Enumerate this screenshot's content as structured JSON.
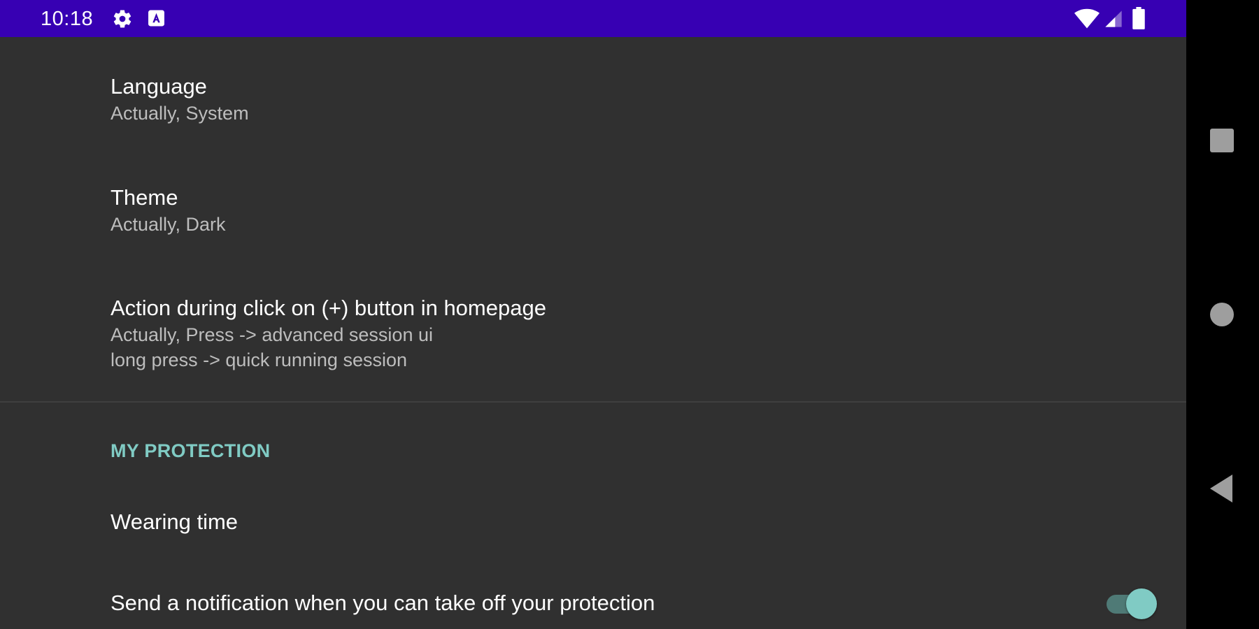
{
  "status_bar": {
    "time": "10:18",
    "icons": [
      "gear-icon",
      "a-icon",
      "wifi-icon",
      "signal-icon",
      "battery-icon"
    ],
    "background": "#3700b3"
  },
  "preferences": [
    {
      "title": "Language",
      "summary": "Actually, System"
    },
    {
      "title": "Theme",
      "summary": "Actually, Dark"
    },
    {
      "title": "Action during click on (+) button in homepage",
      "summary": "Actually, Press -> advanced session ui\nlong press -> quick running session"
    }
  ],
  "category": {
    "title": "MY PROTECTION",
    "accent": "#80cbc4"
  },
  "protection_items": [
    {
      "title": "Wearing time"
    },
    {
      "title": "Send a notification when you can take off your protection",
      "toggle_on": true
    }
  ],
  "navigation": {
    "buttons": [
      "recents-icon",
      "home-icon",
      "back-icon"
    ]
  }
}
